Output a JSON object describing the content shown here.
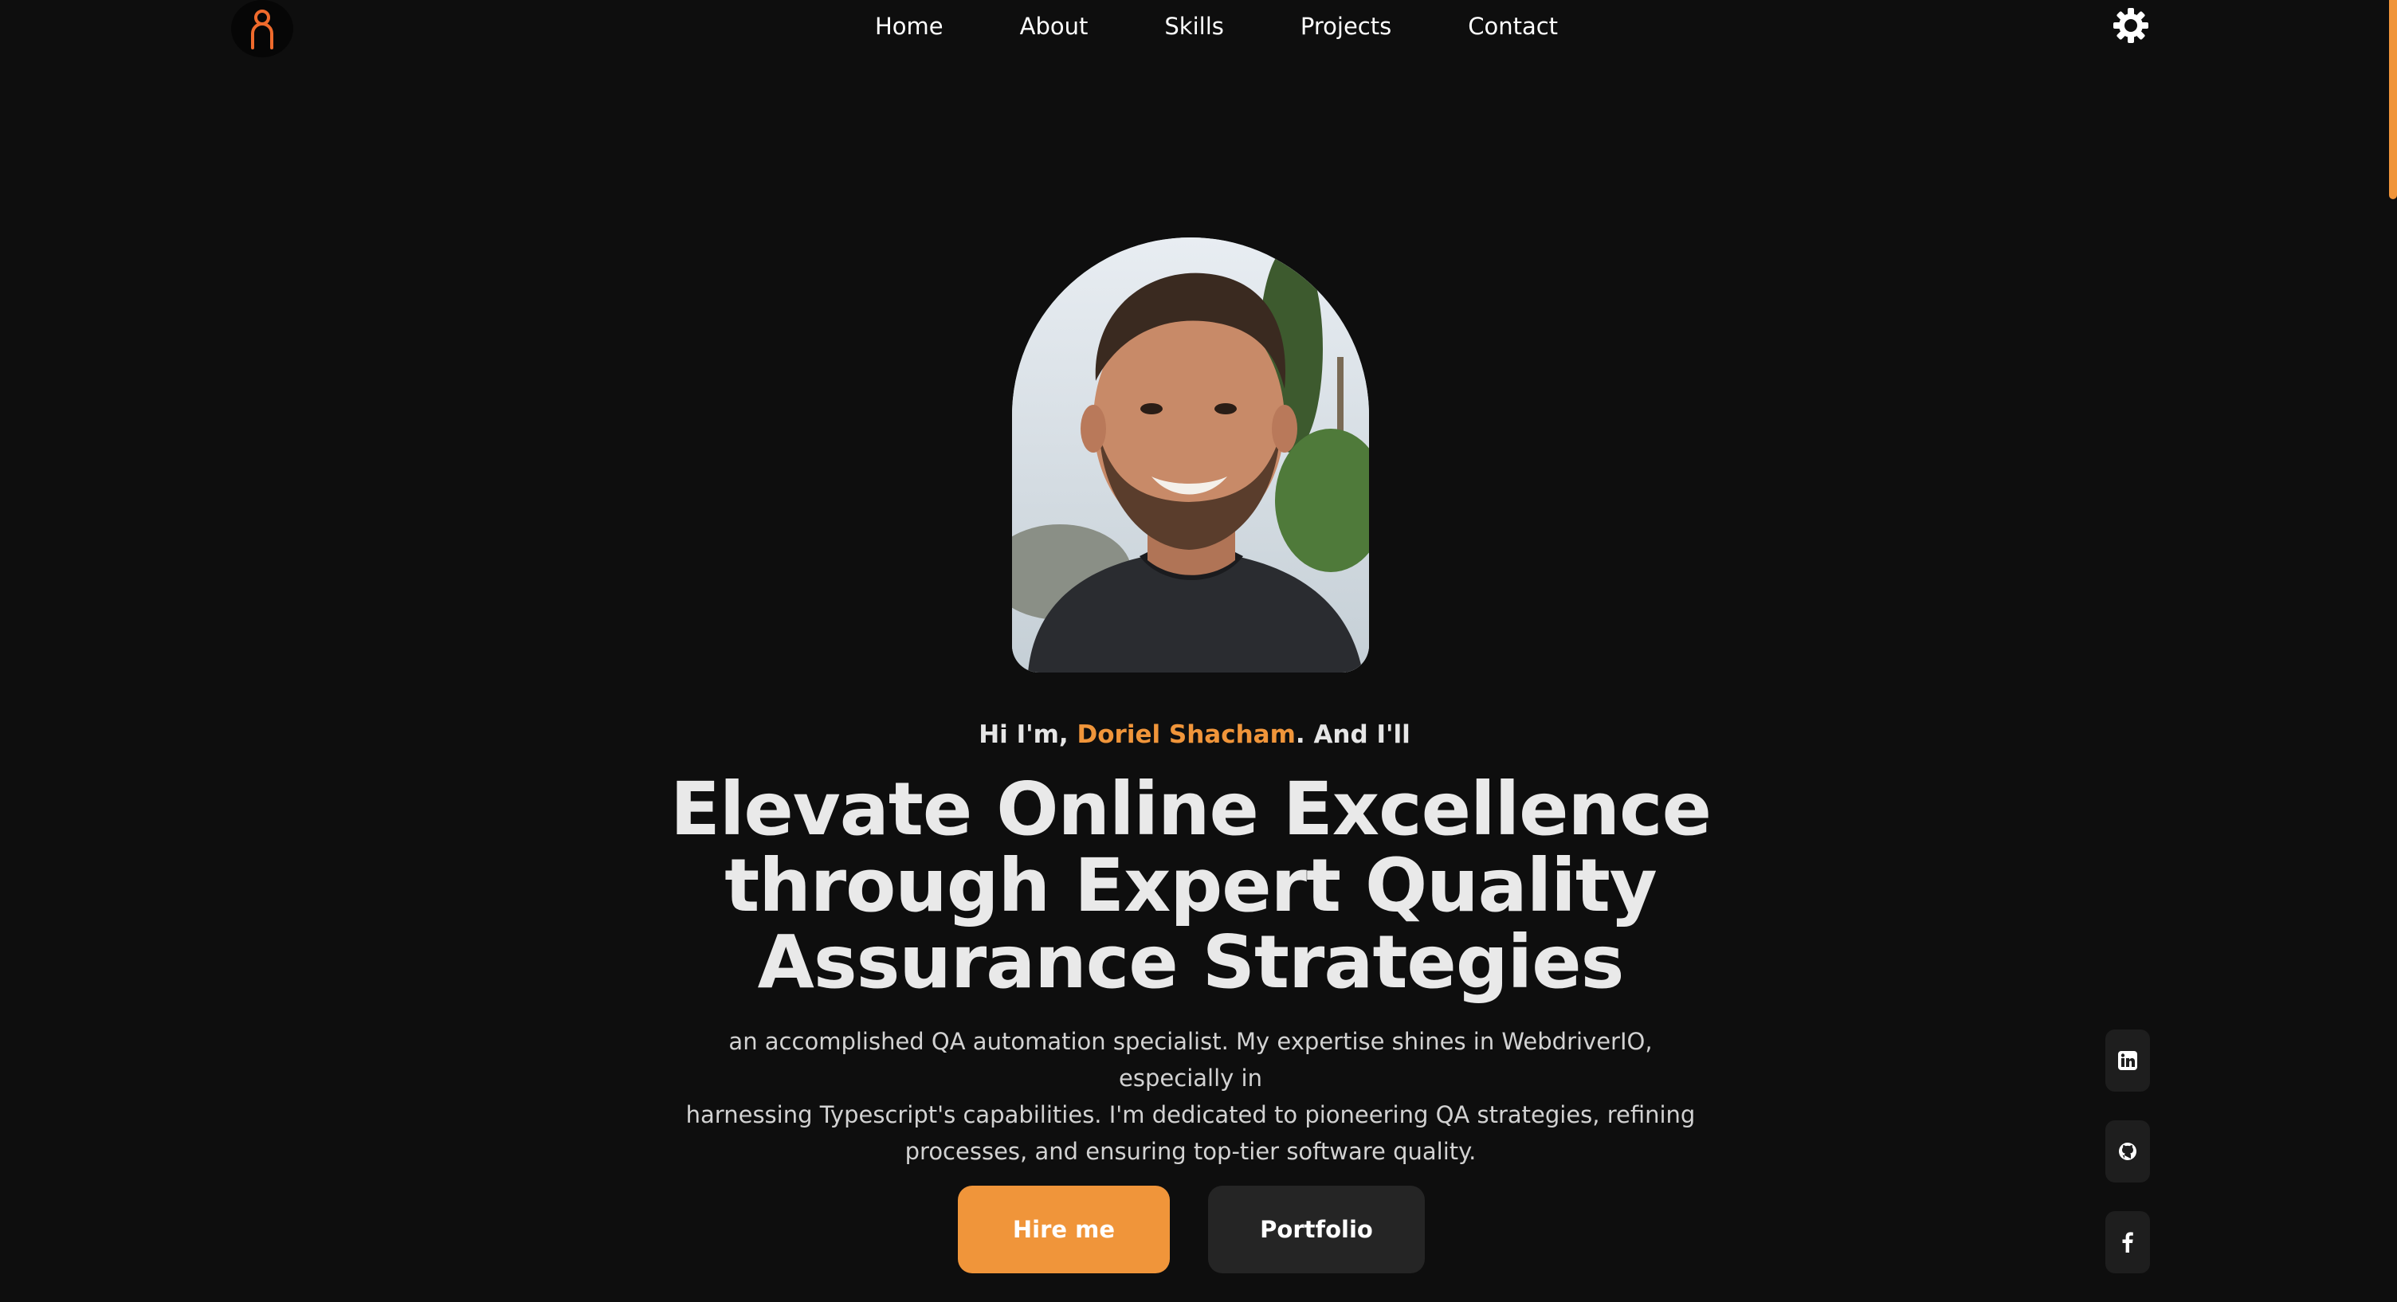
{
  "nav": {
    "logo_icon": "person-logo-icon",
    "links": [
      {
        "label": "Home"
      },
      {
        "label": "About"
      },
      {
        "label": "Skills"
      },
      {
        "label": "Projects"
      },
      {
        "label": "Contact"
      }
    ],
    "theme_icon": "sun-gear-icon"
  },
  "hero": {
    "intro_prefix": "Hi I'm,",
    "name": "Doriel Shacham",
    "intro_suffix": ". And I'll",
    "headline_lines": [
      "Elevate Online Excellence",
      "through Expert Quality",
      "Assurance Strategies"
    ],
    "description_lines": [
      "an accomplished QA automation specialist. My expertise shines in WebdriverIO, especially in",
      "harnessing Typescript's capabilities. I'm dedicated to pioneering QA strategies, refining",
      "processes, and ensuring top-tier software quality."
    ],
    "primary_button": "Hire me",
    "secondary_button": "Portfolio"
  },
  "social": [
    {
      "icon": "linkedin-icon"
    },
    {
      "icon": "github-icon"
    },
    {
      "icon": "facebook-icon"
    }
  ],
  "colors": {
    "background": "#0e0e0e",
    "accent": "#f0953a",
    "text": "#e9e9e9",
    "button_dark": "#252525"
  }
}
